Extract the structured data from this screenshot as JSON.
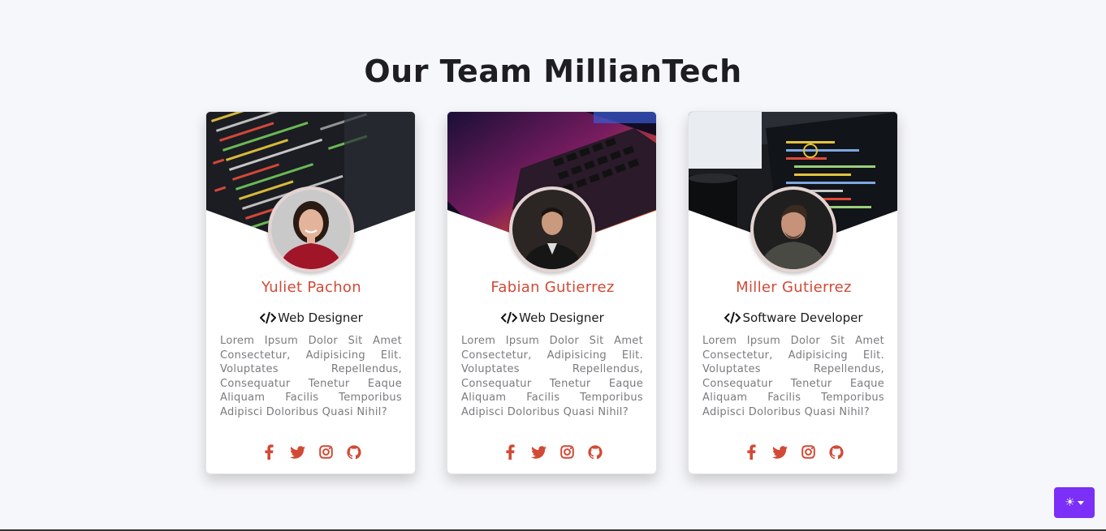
{
  "page": {
    "title": "Our Team MillianTech"
  },
  "team": [
    {
      "name": "Yuliet Pachon",
      "role": "Web Designer",
      "description": "Lorem Ipsum Dolor Sit Amet Consectetur, Adipisicing Elit. Voluptates Repellendus, Consequatur Tenetur Eaque Aliquam Facilis Temporibus Adipisci Doloribus Quasi Nihil?",
      "social": [
        "facebook-icon",
        "twitter-icon",
        "instagram-icon",
        "github-icon"
      ]
    },
    {
      "name": "Fabian Gutierrez",
      "role": "Web Designer",
      "description": "Lorem Ipsum Dolor Sit Amet Consectetur, Adipisicing Elit. Voluptates Repellendus, Consequatur Tenetur Eaque Aliquam Facilis Temporibus Adipisci Doloribus Quasi Nihil?",
      "social": [
        "facebook-icon",
        "twitter-icon",
        "instagram-icon",
        "github-icon"
      ]
    },
    {
      "name": "Miller Gutierrez",
      "role": "Software Developer",
      "description": "Lorem Ipsum Dolor Sit Amet Consectetur, Adipisicing Elit. Voluptates Repellendus, Consequatur Tenetur Eaque Aliquam Facilis Temporibus Adipisci Doloribus Quasi Nihil?",
      "social": [
        "facebook-icon",
        "twitter-icon",
        "instagram-icon",
        "github-icon"
      ]
    }
  ],
  "theme_toggle": {
    "icon": "☀"
  },
  "colors": {
    "accent": "#d14a35",
    "theme_button": "#7b2ff7",
    "background": "#f6f7fa"
  }
}
